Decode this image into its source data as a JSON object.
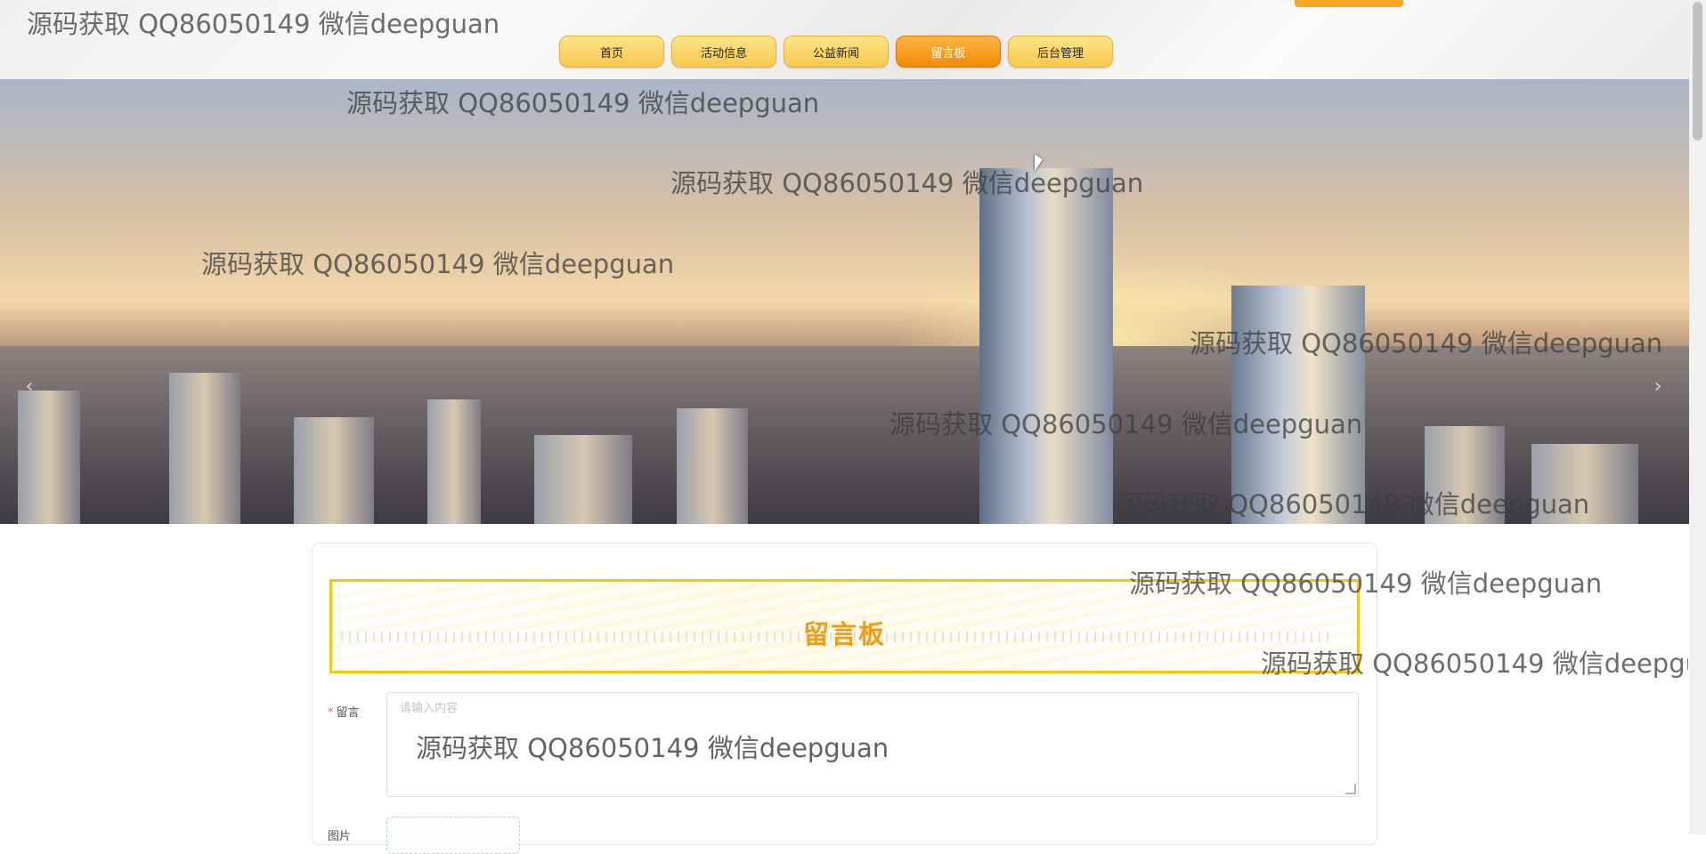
{
  "nav": {
    "items": [
      {
        "label": "首页"
      },
      {
        "label": "活动信息"
      },
      {
        "label": "公益新闻"
      },
      {
        "label": "留言板"
      },
      {
        "label": "后台管理"
      }
    ],
    "active_index": 3
  },
  "banner": {
    "prev_icon": "chevron-left-icon",
    "next_icon": "chevron-right-icon",
    "prev_glyph": "‹",
    "next_glyph": "›",
    "slide_count": 3,
    "active_slide": 3
  },
  "board": {
    "title": "留言板",
    "message_label": "留言",
    "message_placeholder": "请输入内容",
    "message_value": "源码获取 QQ86050149 微信deepguan",
    "image_label": "图片"
  },
  "watermark": {
    "text": "源码获取 QQ86050149 微信deepguan"
  },
  "colors": {
    "accent": "#f39c12",
    "nav_button": "#f9c84a",
    "nav_active": "#f08c00",
    "required": "#f56c6c"
  }
}
